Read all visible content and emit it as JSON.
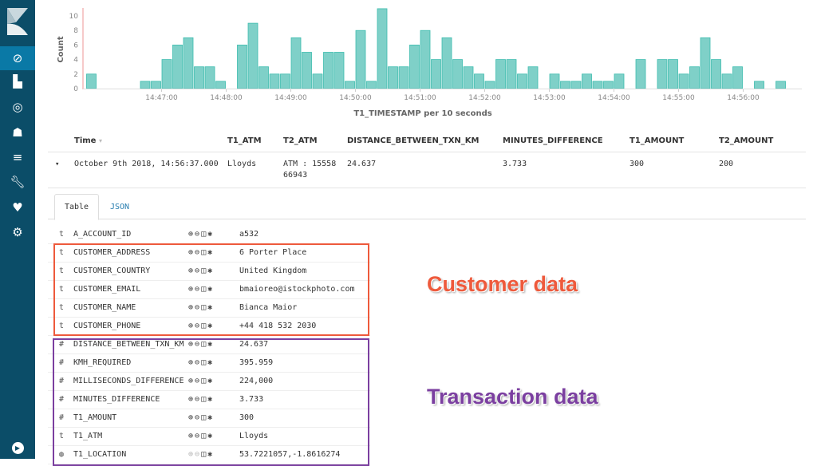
{
  "sidebar": {
    "items": [
      {
        "icon": "compass-icon",
        "label": "Discover",
        "active": true
      },
      {
        "icon": "bar-chart-icon",
        "label": "Visualize"
      },
      {
        "icon": "dashboard-icon",
        "label": "Dashboard"
      },
      {
        "icon": "timelion-icon",
        "label": "Timelion"
      },
      {
        "icon": "apm-icon",
        "label": "APM"
      },
      {
        "icon": "wrench-icon",
        "label": "Dev Tools"
      },
      {
        "icon": "heartbeat-icon",
        "label": "Monitoring"
      },
      {
        "icon": "gear-icon",
        "label": "Management"
      }
    ],
    "bottom_icon": "play-collapse-icon",
    "colors": {
      "background": "#0b4d68",
      "active": "#0a79a6"
    }
  },
  "chart_data": {
    "type": "bar",
    "ylabel": "Count",
    "xlabel": "T1_TIMESTAMP per 10 seconds",
    "ylim": [
      0,
      11
    ],
    "yticks": [
      0,
      2,
      4,
      6,
      8,
      10
    ],
    "xticks": [
      "14:47:00",
      "14:48:00",
      "14:49:00",
      "14:50:00",
      "14:51:00",
      "14:52:00",
      "14:53:00",
      "14:54:00",
      "14:55:00",
      "14:56:00"
    ],
    "bar_color": "#7fd0c8",
    "grid": false,
    "x": [
      "14:45:50",
      "14:46:00",
      "14:46:10",
      "14:46:20",
      "14:46:30",
      "14:46:40",
      "14:46:50",
      "14:47:00",
      "14:47:10",
      "14:47:20",
      "14:47:30",
      "14:47:40",
      "14:47:50",
      "14:48:00",
      "14:48:10",
      "14:48:20",
      "14:48:30",
      "14:48:40",
      "14:48:50",
      "14:49:00",
      "14:49:10",
      "14:49:20",
      "14:49:30",
      "14:49:40",
      "14:49:50",
      "14:50:00",
      "14:50:10",
      "14:50:20",
      "14:50:30",
      "14:50:40",
      "14:50:50",
      "14:51:00",
      "14:51:10",
      "14:51:20",
      "14:51:30",
      "14:51:40",
      "14:51:50",
      "14:52:00",
      "14:52:10",
      "14:52:20",
      "14:52:30",
      "14:52:40",
      "14:52:50",
      "14:53:00",
      "14:53:10",
      "14:53:20",
      "14:53:30",
      "14:53:40",
      "14:53:50",
      "14:54:00",
      "14:54:10",
      "14:54:20",
      "14:54:30",
      "14:54:40",
      "14:54:50",
      "14:55:00",
      "14:55:10",
      "14:55:20",
      "14:55:30",
      "14:55:40",
      "14:55:50",
      "14:56:00",
      "14:56:10",
      "14:56:20",
      "14:56:30",
      "14:56:40"
    ],
    "values": [
      2,
      0,
      0,
      0,
      0,
      1,
      1,
      4,
      6,
      7,
      3,
      3,
      1,
      0,
      6,
      9,
      3,
      2,
      2,
      7,
      5,
      2,
      5,
      5,
      1,
      8,
      1,
      11,
      3,
      3,
      6,
      8,
      4,
      7,
      4,
      3,
      2,
      1,
      4,
      4,
      2,
      3,
      0,
      2,
      1,
      1,
      2,
      1,
      1,
      2,
      0,
      4,
      0,
      4,
      4,
      2,
      3,
      7,
      4,
      2,
      3,
      0,
      1,
      0,
      1
    ]
  },
  "doc_table": {
    "headers": [
      "Time",
      "T1_ATM",
      "T2_ATM",
      "DISTANCE_BETWEEN_TXN_KM",
      "MINUTES_DIFFERENCE",
      "T1_AMOUNT",
      "T2_AMOUNT"
    ],
    "sort_icon": "sort-down-icon",
    "row": {
      "expand_icon": "caret-down-icon",
      "time": "October 9th 2018, 14:56:37.000",
      "t1_atm": "Lloyds",
      "t2_atm": "ATM : 15558 66943",
      "distance": "24.637",
      "minutes": "3.733",
      "t1_amount": "300",
      "t2_amount": "200"
    }
  },
  "tabs": [
    "Table",
    "JSON"
  ],
  "field_icons": "⊕ ⊖ ◫ ✱",
  "fields": [
    {
      "type": "t",
      "name": "A_ACCOUNT_ID",
      "value": "a532"
    },
    {
      "type": "t",
      "name": "CUSTOMER_ADDRESS",
      "value": "6 Porter Place"
    },
    {
      "type": "t",
      "name": "CUSTOMER_COUNTRY",
      "value": "United Kingdom"
    },
    {
      "type": "t",
      "name": "CUSTOMER_EMAIL",
      "value": "bmaioreo@istockphoto.com"
    },
    {
      "type": "t",
      "name": "CUSTOMER_NAME",
      "value": "Bianca Maior"
    },
    {
      "type": "t",
      "name": "CUSTOMER_PHONE",
      "value": "+44 418 532 2030"
    },
    {
      "type": "#",
      "name": "DISTANCE_BETWEEN_TXN_KM",
      "value": "24.637"
    },
    {
      "type": "#",
      "name": "KMH_REQUIRED",
      "value": "395.959"
    },
    {
      "type": "#",
      "name": "MILLISECONDS_DIFFERENCE",
      "value": "224,000"
    },
    {
      "type": "#",
      "name": "MINUTES_DIFFERENCE",
      "value": "3.733"
    },
    {
      "type": "#",
      "name": "T1_AMOUNT",
      "value": "300"
    },
    {
      "type": "t",
      "name": "T1_ATM",
      "value": "Lloyds"
    },
    {
      "type": "◍",
      "name": "T1_LOCATION",
      "value": "53.7221057,-1.8616274"
    }
  ],
  "annotations": {
    "customer": {
      "label": "Customer data",
      "color": "#ee5a3c"
    },
    "transaction": {
      "label": "Transaction data",
      "color": "#7b3fa0"
    }
  }
}
